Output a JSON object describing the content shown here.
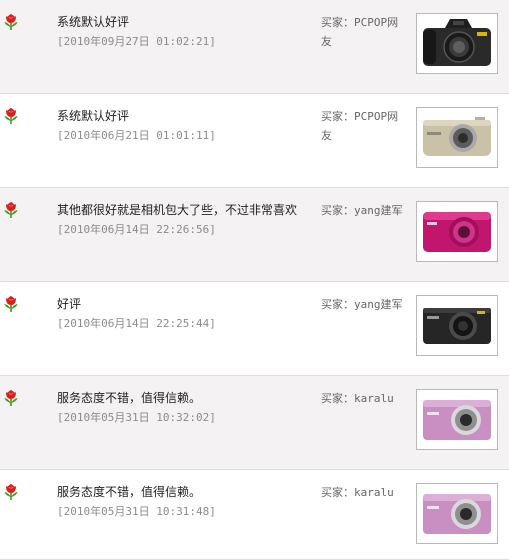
{
  "reviews": [
    {
      "comment": "系统默认好评",
      "time": "[2010年09月27日 01:02:21]",
      "buyer": "买家：PCPOP网友",
      "flower_icon": "red-flower-icon",
      "product_image": "black-dslr-camera"
    },
    {
      "comment": "系统默认好评",
      "time": "[2010年06月21日 01:01:11]",
      "buyer": "买家：PCPOP网友",
      "flower_icon": "red-flower-icon",
      "product_image": "champagne-compact-camera"
    },
    {
      "comment": "其他都很好就是相机包大了些，不过非常喜欢",
      "time": "[2010年06月14日 22:26:56]",
      "buyer": "买家：yang建军",
      "flower_icon": "red-flower-icon",
      "product_image": "magenta-compact-camera"
    },
    {
      "comment": "好评",
      "time": "[2010年06月14日 22:25:44]",
      "buyer": "买家：yang建军",
      "flower_icon": "red-flower-icon",
      "product_image": "black-compact-camera"
    },
    {
      "comment": "服务态度不错，值得信赖。",
      "time": "[2010年05月31日 10:32:02]",
      "buyer": "买家：karalu",
      "flower_icon": "red-flower-icon",
      "product_image": "pink-compact-camera"
    },
    {
      "comment": "服务态度不错，值得信赖。",
      "time": "[2010年05月31日 10:31:48]",
      "buyer": "买家：karalu",
      "flower_icon": "red-flower-icon",
      "product_image": "pink-compact-camera"
    }
  ],
  "colors": {
    "row_shade": "#f4f2f2",
    "row_border": "#e3dcdc",
    "flower_red": "#d8201e",
    "leaf_green": "#3f9a20",
    "time_gray": "#8c8c8c"
  }
}
